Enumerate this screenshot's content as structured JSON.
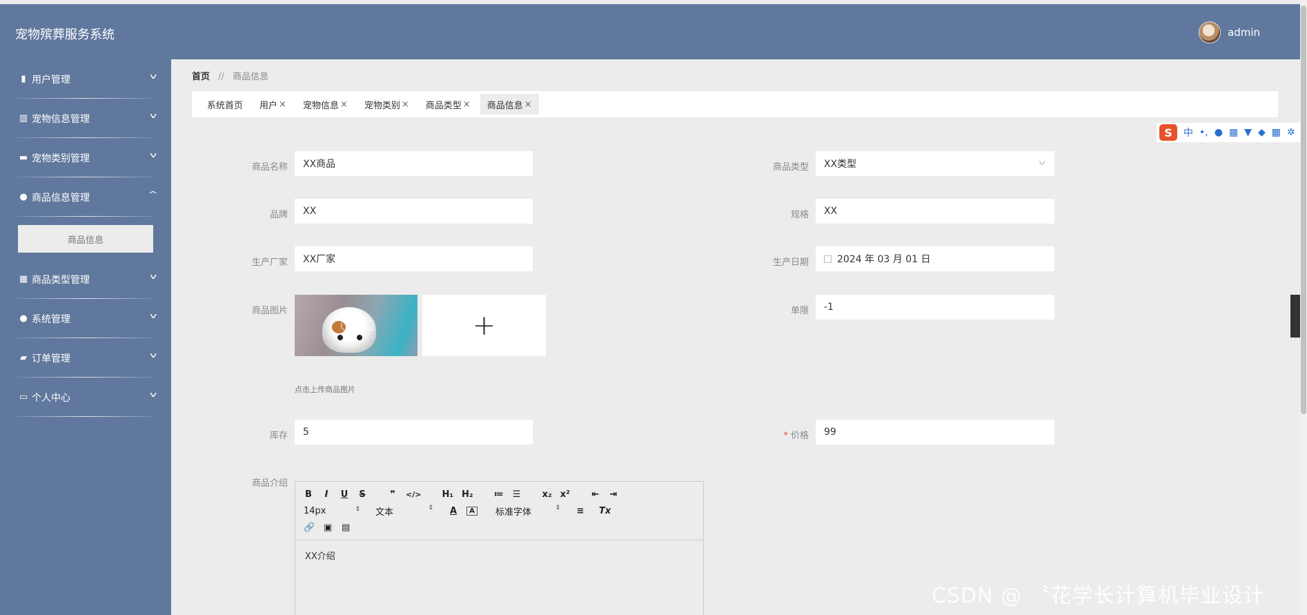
{
  "app": {
    "title": "宠物殡葬服务系统",
    "user": "admin"
  },
  "sidebar": {
    "items": [
      {
        "label": "用户管理",
        "icon": "clipboard-icon",
        "glyph": "▮",
        "expanded": false
      },
      {
        "label": "宠物信息管理",
        "icon": "chart-icon",
        "glyph": "▥",
        "expanded": false
      },
      {
        "label": "宠物类别管理",
        "icon": "chat-icon",
        "glyph": "▬",
        "expanded": false
      },
      {
        "label": "商品信息管理",
        "icon": "user-icon",
        "glyph": "●",
        "expanded": true
      },
      {
        "label": "商品类型管理",
        "icon": "grid-icon",
        "glyph": "▦",
        "expanded": false
      },
      {
        "label": "系统管理",
        "icon": "person-icon",
        "glyph": "●",
        "expanded": false
      },
      {
        "label": "订单管理",
        "icon": "briefcase-icon",
        "glyph": "▰",
        "expanded": false
      },
      {
        "label": "个人中心",
        "icon": "card-icon",
        "glyph": "▭",
        "expanded": false
      }
    ],
    "submenu": {
      "label": "商品信息"
    }
  },
  "breadcrumb": {
    "home": "首页",
    "sep": "//",
    "current": "商品信息"
  },
  "tabs": [
    {
      "label": "系统首页",
      "closable": false,
      "active": false
    },
    {
      "label": "用户",
      "closable": true,
      "active": false
    },
    {
      "label": "宠物信息",
      "closable": true,
      "active": false
    },
    {
      "label": "宠物类别",
      "closable": true,
      "active": false
    },
    {
      "label": "商品类型",
      "closable": true,
      "active": false
    },
    {
      "label": "商品信息",
      "closable": true,
      "active": true
    }
  ],
  "ime": {
    "logo": "S",
    "lang": "中",
    "punct": "•,"
  },
  "form": {
    "name": {
      "label": "商品名称",
      "value": "XX商品"
    },
    "type": {
      "label": "商品类型",
      "value": "XX类型"
    },
    "brand": {
      "label": "品牌",
      "value": "XX"
    },
    "spec": {
      "label": "规格",
      "value": "XX"
    },
    "maker": {
      "label": "生产厂家",
      "value": "XX厂家"
    },
    "date": {
      "label": "生产日期",
      "value": "2024 年 03 月 01 日"
    },
    "image": {
      "label": "商品图片",
      "tip": "点击上传商品图片",
      "add": "+"
    },
    "limit": {
      "label": "单限",
      "value": "-1"
    },
    "stock": {
      "label": "库存",
      "value": "5"
    },
    "price": {
      "label": "价格",
      "required_mark": "*",
      "value": "99"
    },
    "intro": {
      "label": "商品介绍",
      "value": "XX介绍"
    }
  },
  "editor": {
    "row1": [
      "B",
      "I",
      "U",
      "S",
      "❞",
      "</>",
      "H₁",
      "H₂",
      "≔",
      "☰",
      "x₂",
      "x²",
      "⇤",
      "⇥"
    ],
    "size": "14px",
    "format": "文本",
    "font": "标准字体",
    "row2_buttons": [
      "A",
      "A",
      "≡",
      "Tx"
    ],
    "row3": [
      "🔗",
      "▣",
      "▤"
    ]
  },
  "watermark": "CSDN @ 〝花学长计算机毕业设计"
}
